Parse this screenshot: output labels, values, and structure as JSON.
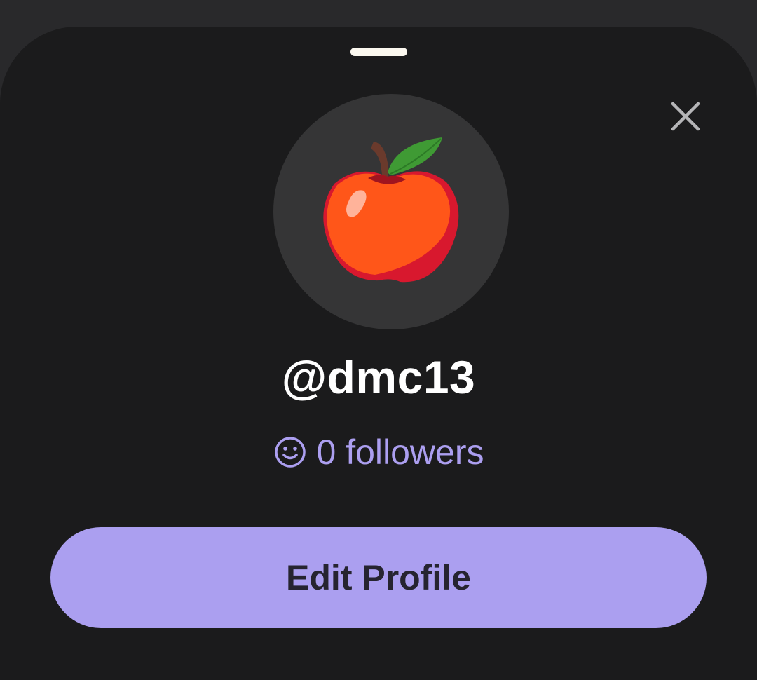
{
  "profile_sheet": {
    "username": "@dmc13",
    "followers_label": "0 followers",
    "avatar_icon": "red-apple-emoji",
    "edit_button_label": "Edit Profile"
  },
  "icons": {
    "close": "close-icon",
    "followers": "smiley-face-icon",
    "grabber": "drag-handle"
  },
  "colors": {
    "accent": "#ab9ff0",
    "sheet_background": "#1b1b1c",
    "avatar_background": "#353536",
    "text_primary": "#ffffff"
  }
}
